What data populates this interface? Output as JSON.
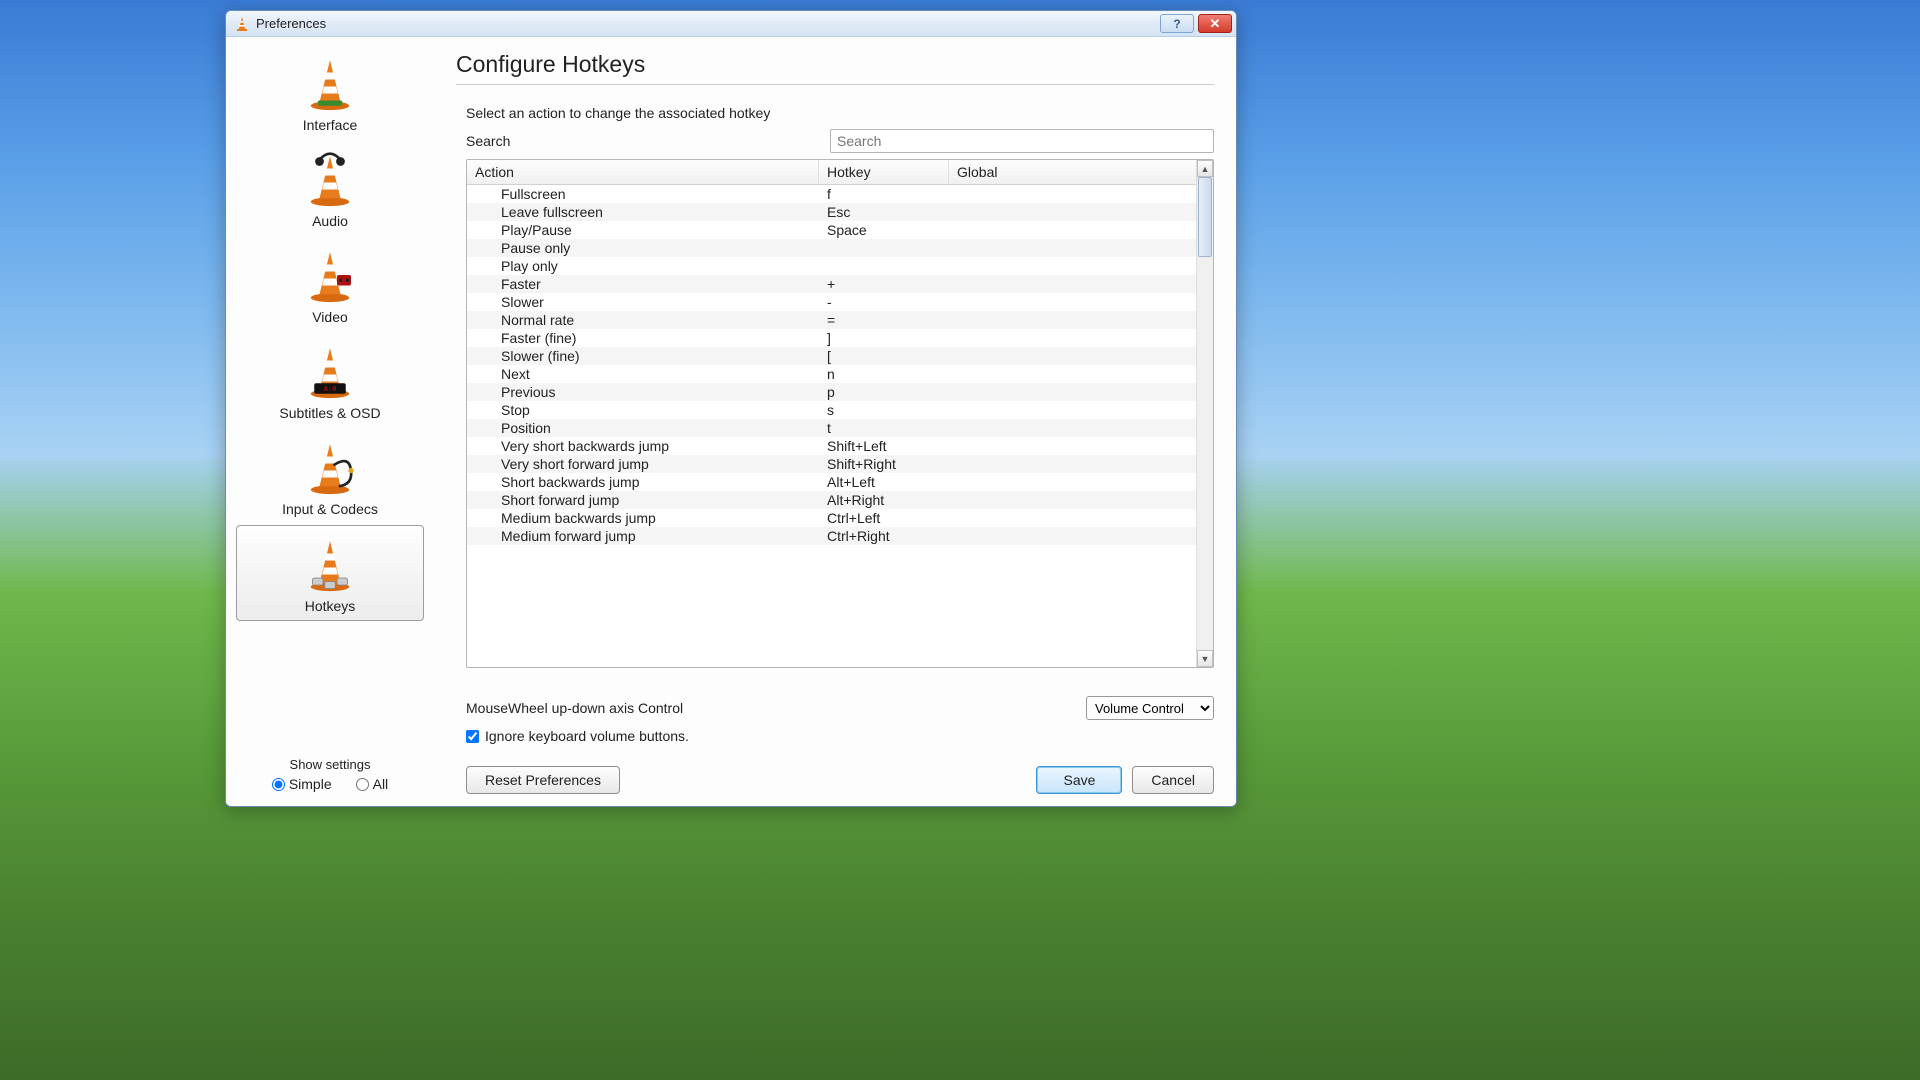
{
  "window": {
    "title": "Preferences"
  },
  "sidebar": {
    "items": [
      {
        "key": "interface",
        "label": "Interface"
      },
      {
        "key": "audio",
        "label": "Audio"
      },
      {
        "key": "video",
        "label": "Video"
      },
      {
        "key": "subtitles",
        "label": "Subtitles & OSD"
      },
      {
        "key": "codecs",
        "label": "Input & Codecs"
      },
      {
        "key": "hotkeys",
        "label": "Hotkeys"
      }
    ],
    "selected": "hotkeys",
    "show_settings_label": "Show settings",
    "radio_simple": "Simple",
    "radio_all": "All",
    "radio_selected": "simple"
  },
  "main": {
    "heading": "Configure Hotkeys",
    "instruction": "Select an action to change the associated hotkey",
    "search_label": "Search",
    "search_placeholder": "Search",
    "columns": {
      "action": "Action",
      "hotkey": "Hotkey",
      "global": "Global"
    },
    "rows": [
      {
        "action": "Fullscreen",
        "hotkey": "f",
        "global": ""
      },
      {
        "action": "Leave fullscreen",
        "hotkey": "Esc",
        "global": ""
      },
      {
        "action": "Play/Pause",
        "hotkey": "Space",
        "global": ""
      },
      {
        "action": "Pause only",
        "hotkey": "",
        "global": ""
      },
      {
        "action": "Play only",
        "hotkey": "",
        "global": ""
      },
      {
        "action": "Faster",
        "hotkey": "+",
        "global": ""
      },
      {
        "action": "Slower",
        "hotkey": "-",
        "global": ""
      },
      {
        "action": "Normal rate",
        "hotkey": "=",
        "global": ""
      },
      {
        "action": "Faster (fine)",
        "hotkey": "]",
        "global": ""
      },
      {
        "action": "Slower (fine)",
        "hotkey": "[",
        "global": ""
      },
      {
        "action": "Next",
        "hotkey": "n",
        "global": ""
      },
      {
        "action": "Previous",
        "hotkey": "p",
        "global": ""
      },
      {
        "action": "Stop",
        "hotkey": "s",
        "global": ""
      },
      {
        "action": "Position",
        "hotkey": "t",
        "global": ""
      },
      {
        "action": "Very short backwards jump",
        "hotkey": "Shift+Left",
        "global": ""
      },
      {
        "action": "Very short forward jump",
        "hotkey": "Shift+Right",
        "global": ""
      },
      {
        "action": "Short backwards jump",
        "hotkey": "Alt+Left",
        "global": ""
      },
      {
        "action": "Short forward jump",
        "hotkey": "Alt+Right",
        "global": ""
      },
      {
        "action": "Medium backwards jump",
        "hotkey": "Ctrl+Left",
        "global": ""
      },
      {
        "action": "Medium forward jump",
        "hotkey": "Ctrl+Right",
        "global": ""
      }
    ],
    "wheel_label": "MouseWheel up-down axis Control",
    "wheel_value": "Volume Control",
    "ignore_kbvol": "Ignore keyboard volume buttons.",
    "ignore_checked": true
  },
  "footer": {
    "reset": "Reset Preferences",
    "save": "Save",
    "cancel": "Cancel"
  }
}
